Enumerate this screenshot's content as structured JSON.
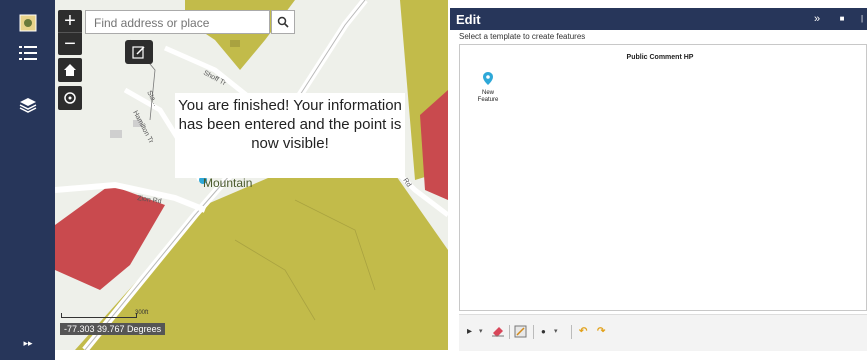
{
  "sidebar": {
    "collapse_glyph": "▸▸",
    "icons": [
      "app-logo-icon",
      "layer-list-icon",
      "basemap-layers-icon",
      "expand-sidebar-icon"
    ]
  },
  "map": {
    "zoom_in": "+",
    "zoom_out": "−",
    "search": {
      "placeholder": "Find address or place"
    },
    "message": "You are finished! Your information has been entered and the point is now visible!",
    "place_label": "Mountain",
    "street_labels": [
      "Shoff Tr",
      "Hamilton Tr",
      "Zion Rd",
      "Sta...",
      "Rd"
    ],
    "scale_label": "300ft",
    "coordinates": "-77.303 39.767 Degrees",
    "colors": {
      "parcel_yellow": "#c2bb4a",
      "parcel_red": "#c94a4e",
      "background": "#eef0ea"
    }
  },
  "edit_panel": {
    "title": "Edit",
    "collapse_glyph": "»",
    "maximize_glyph": "■",
    "instruction": "Select a template to create features",
    "layer_name": "Public Comment HP",
    "template": {
      "label_line1": "New",
      "label_line2": "Feature"
    },
    "colors": {
      "header": "#27365a",
      "point_marker": "#2ea8d8"
    }
  }
}
